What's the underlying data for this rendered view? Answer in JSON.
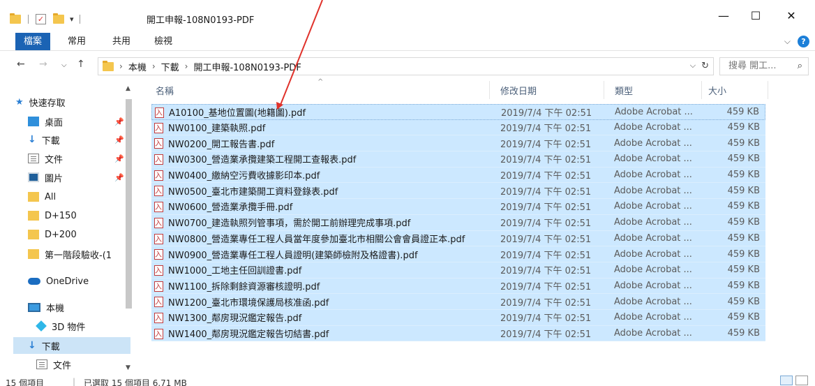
{
  "window": {
    "title": "開工申報-108N0193-PDF",
    "minimize_label": "—",
    "maximize_label": "☐",
    "close_label": "✕"
  },
  "ribbon": {
    "tabs": [
      "檔案",
      "常用",
      "共用",
      "檢視"
    ]
  },
  "address": {
    "crumbs": [
      "本機",
      "下載",
      "開工申報-108N0193-PDF"
    ],
    "search_placeholder": "搜尋 開工...",
    "separator": "›"
  },
  "nav_pane": {
    "quick_access": "快速存取",
    "pinned": [
      "桌面",
      "下載",
      "文件",
      "圖片"
    ],
    "folders": [
      "All",
      "D+150",
      "D+200",
      "第一階段驗收-(1"
    ],
    "onedrive": "OneDrive",
    "this_pc": "本機",
    "pc_items": [
      "3D 物件",
      "下載",
      "文件"
    ]
  },
  "columns": {
    "name": "名稱",
    "date": "修改日期",
    "type": "類型",
    "size": "大小"
  },
  "files": [
    {
      "name": "A10100_基地位置圖(地籍圖).pdf",
      "date": "2019/7/4 下午 02:51",
      "type": "Adobe Acrobat ...",
      "size": "459 KB"
    },
    {
      "name": "NW0100_建築執照.pdf",
      "date": "2019/7/4 下午 02:51",
      "type": "Adobe Acrobat ...",
      "size": "459 KB"
    },
    {
      "name": "NW0200_開工報告書.pdf",
      "date": "2019/7/4 下午 02:51",
      "type": "Adobe Acrobat ...",
      "size": "459 KB"
    },
    {
      "name": "NW0300_營造業承攬建築工程開工查報表.pdf",
      "date": "2019/7/4 下午 02:51",
      "type": "Adobe Acrobat ...",
      "size": "459 KB"
    },
    {
      "name": "NW0400_繳納空污費收據影印本.pdf",
      "date": "2019/7/4 下午 02:51",
      "type": "Adobe Acrobat ...",
      "size": "459 KB"
    },
    {
      "name": "NW0500_臺北市建築開工資料登錄表.pdf",
      "date": "2019/7/4 下午 02:51",
      "type": "Adobe Acrobat ...",
      "size": "459 KB"
    },
    {
      "name": "NW0600_營造業承攬手冊.pdf",
      "date": "2019/7/4 下午 02:51",
      "type": "Adobe Acrobat ...",
      "size": "459 KB"
    },
    {
      "name": "NW0700_建造執照列管事項，需於開工前辦理完成事項.pdf",
      "date": "2019/7/4 下午 02:51",
      "type": "Adobe Acrobat ...",
      "size": "459 KB"
    },
    {
      "name": "NW0800_營造業專任工程人員當年度參加臺北市相關公會會員證正本.pdf",
      "date": "2019/7/4 下午 02:51",
      "type": "Adobe Acrobat ...",
      "size": "459 KB"
    },
    {
      "name": "NW0900_營造業專任工程人員證明(建築師檢附及格證書).pdf",
      "date": "2019/7/4 下午 02:51",
      "type": "Adobe Acrobat ...",
      "size": "459 KB"
    },
    {
      "name": "NW1000_工地主任回訓證書.pdf",
      "date": "2019/7/4 下午 02:51",
      "type": "Adobe Acrobat ...",
      "size": "459 KB"
    },
    {
      "name": "NW1100_拆除剩餘資源審核證明.pdf",
      "date": "2019/7/4 下午 02:51",
      "type": "Adobe Acrobat ...",
      "size": "459 KB"
    },
    {
      "name": "NW1200_臺北市環境保護局核准函.pdf",
      "date": "2019/7/4 下午 02:51",
      "type": "Adobe Acrobat ...",
      "size": "459 KB"
    },
    {
      "name": "NW1300_鄰房現況鑑定報告.pdf",
      "date": "2019/7/4 下午 02:51",
      "type": "Adobe Acrobat ...",
      "size": "459 KB"
    },
    {
      "name": "NW1400_鄰房現況鑑定報告切結書.pdf",
      "date": "2019/7/4 下午 02:51",
      "type": "Adobe Acrobat ...",
      "size": "459 KB"
    }
  ],
  "status": {
    "count": "15 個項目",
    "selected": "已選取 15 個項目 6.71 MB"
  },
  "colors": {
    "selection": "#cce8ff",
    "file_tab": "#1b63b4",
    "annotation_arrow": "#e0322b"
  }
}
